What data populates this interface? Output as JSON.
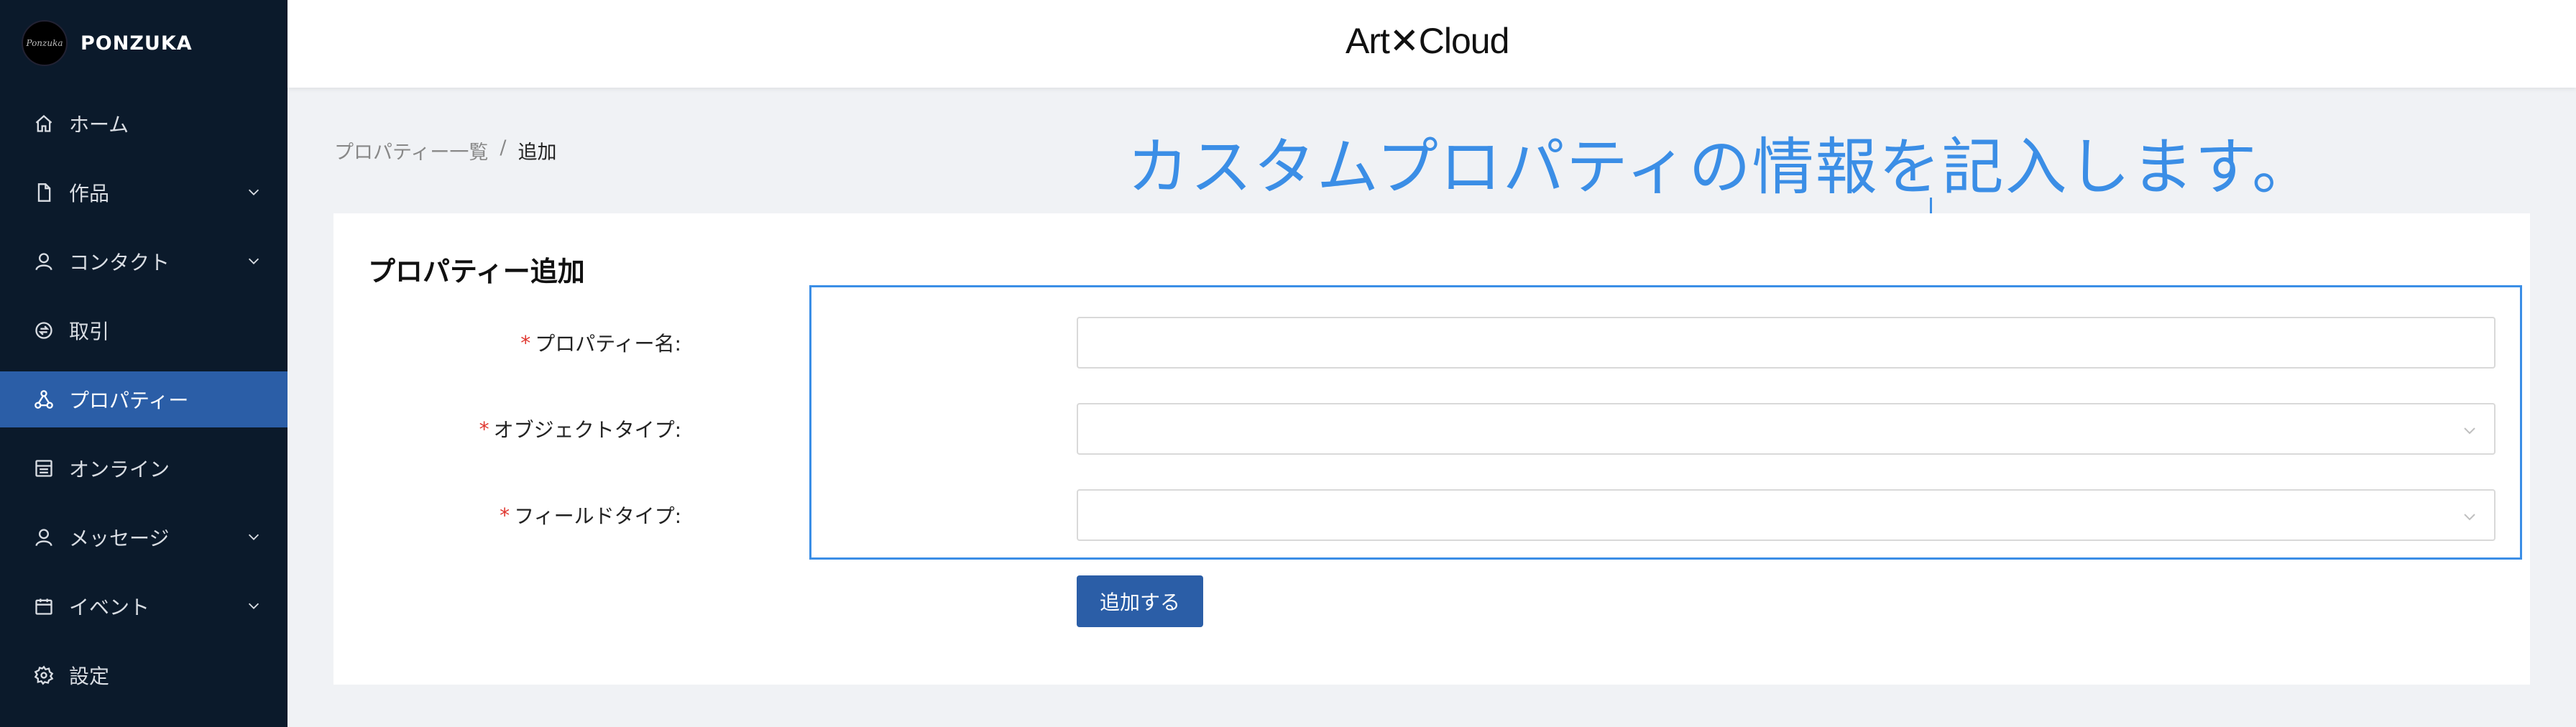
{
  "sidebar": {
    "brand_logo_text": "Ponzuka",
    "brand_name": "PONZUKA",
    "items": [
      {
        "label": "ホーム",
        "icon": "home-icon",
        "has_chevron": false,
        "active": false
      },
      {
        "label": "作品",
        "icon": "file-icon",
        "has_chevron": true,
        "active": false
      },
      {
        "label": "コンタクト",
        "icon": "user-icon",
        "has_chevron": true,
        "active": false
      },
      {
        "label": "取引",
        "icon": "exchange-icon",
        "has_chevron": false,
        "active": false
      },
      {
        "label": "プロパティー",
        "icon": "share-nodes-icon",
        "has_chevron": false,
        "active": true
      },
      {
        "label": "オンライン",
        "icon": "shop-icon",
        "has_chevron": false,
        "active": false
      },
      {
        "label": "メッセージ",
        "icon": "user-icon",
        "has_chevron": true,
        "active": false
      },
      {
        "label": "イベント",
        "icon": "calendar-icon",
        "has_chevron": true,
        "active": false
      },
      {
        "label": "設定",
        "icon": "gear-icon",
        "has_chevron": false,
        "active": false
      }
    ]
  },
  "header": {
    "logo": "Art✕Cloud"
  },
  "breadcrumb": {
    "parent": "プロパティー一覧",
    "separator": "/",
    "current": "追加"
  },
  "annotation": {
    "text": "カスタムプロパティの情報を記入します。",
    "color": "#3b8ee6"
  },
  "form": {
    "title": "プロパティー追加",
    "fields": [
      {
        "label": "プロパティー名:",
        "required": true,
        "type": "text",
        "value": ""
      },
      {
        "label": "オブジェクトタイプ:",
        "required": true,
        "type": "select",
        "value": ""
      },
      {
        "label": "フィールドタイプ:",
        "required": true,
        "type": "select",
        "value": ""
      }
    ],
    "submit_label": "追加する"
  },
  "colors": {
    "sidebar_bg": "#0b1a2b",
    "active_bg": "#2b5ea7",
    "primary": "#2b5ea7",
    "required": "#e0362f"
  }
}
